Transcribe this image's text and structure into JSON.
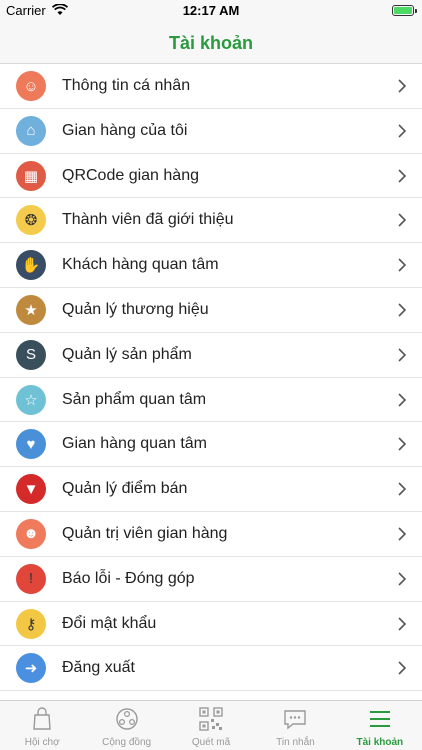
{
  "status": {
    "carrier": "Carrier",
    "time": "12:17 AM"
  },
  "header": {
    "title": "Tài khoản"
  },
  "menu": [
    {
      "label": "Thông tin cá nhân",
      "icon": "person-icon",
      "color": "#ee7a5a"
    },
    {
      "label": "Gian hàng của tôi",
      "icon": "store-icon",
      "color": "#6fb0dc"
    },
    {
      "label": "QRCode gian hàng",
      "icon": "qrcode-icon",
      "color": "#e05b45"
    },
    {
      "label": "Thành viên đã giới thiệu",
      "icon": "network-icon",
      "color": "#f5cb4d"
    },
    {
      "label": "Khách hàng quan tâm",
      "icon": "handshake-icon",
      "color": "#3a4d66"
    },
    {
      "label": "Quản lý thương hiệu",
      "icon": "award-icon",
      "color": "#c08a3e"
    },
    {
      "label": "Quản lý sản phẩm",
      "icon": "shopify-icon",
      "color": "#3a4f5c"
    },
    {
      "label": "Sản phẩm quan tâm",
      "icon": "box-star-icon",
      "color": "#6fc2d6"
    },
    {
      "label": "Gian hàng quan tâm",
      "icon": "shop-heart-icon",
      "color": "#4a90d9"
    },
    {
      "label": "Quản lý điểm bán",
      "icon": "location-pin-icon",
      "color": "#d42a2a"
    },
    {
      "label": "Quản trị viên gian hàng",
      "icon": "admin-icon",
      "color": "#f07a5c"
    },
    {
      "label": "Báo lỗi - Đóng góp",
      "icon": "warning-icon",
      "color": "#e0463a"
    },
    {
      "label": "Đổi mật khẩu",
      "icon": "key-icon",
      "color": "#f2c744"
    },
    {
      "label": "Đăng xuất",
      "icon": "logout-icon",
      "color": "#4a8fe0"
    }
  ],
  "tabs": [
    {
      "label": "Hội chợ",
      "icon": "shopping-bag-icon"
    },
    {
      "label": "Cộng đồng",
      "icon": "community-icon"
    },
    {
      "label": "Quét mã",
      "icon": "qr-scan-icon"
    },
    {
      "label": "Tin nhắn",
      "icon": "chat-icon"
    },
    {
      "label": "Tài khoản",
      "icon": "menu-icon"
    }
  ],
  "colors": {
    "accent": "#2a9a3e",
    "inactive": "#9a9a9a"
  }
}
